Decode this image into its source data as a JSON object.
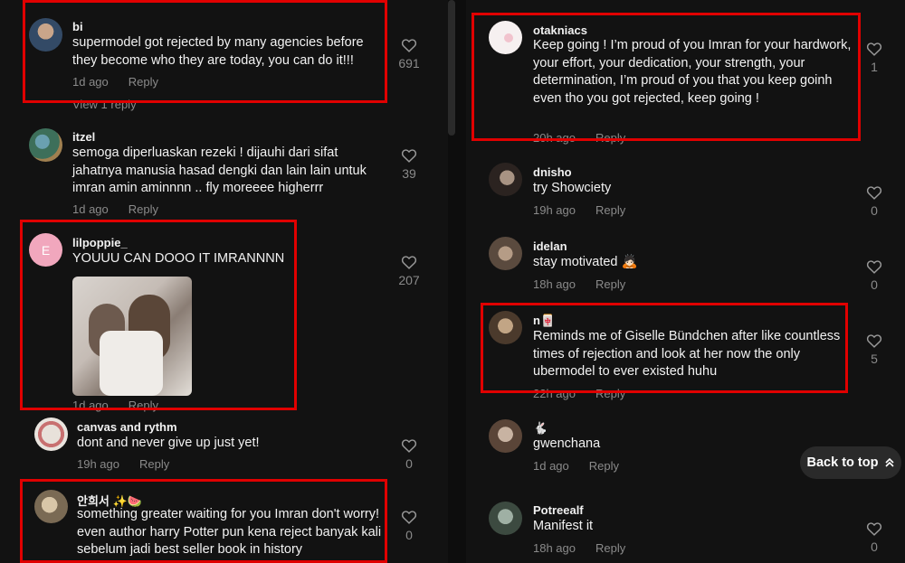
{
  "left": [
    {
      "username": "bi",
      "text": "supermodel got rejected by many agencies before they become who they are today, you can do it!!!",
      "time": "1d ago",
      "reply": "Reply",
      "likes": "691",
      "view_replies": "View 1 reply"
    },
    {
      "username": "itzel",
      "text": "semoga diperluaskan rezeki ! dijauhi dari sifat jahatnya manusia hasad dengki dan lain lain untuk imran amin aminnnn .. fly moreeee higherrr",
      "time": "1d ago",
      "reply": "Reply",
      "likes": "39"
    },
    {
      "username": "lilpoppie_",
      "text": "YOUUU CAN DOOO IT IMRANNNN",
      "time": "1d ago",
      "reply": "Reply",
      "likes": "207",
      "avatar_letter": "E"
    },
    {
      "username": "canvas and rythm",
      "text": "dont and never give up just yet!",
      "time": "19h ago",
      "reply": "Reply",
      "likes": "0"
    },
    {
      "username": "안희서 ✨🍉",
      "text": "something greater waiting for you Imran don't worry! even author harry Potter pun kena reject banyak kali sebelum jadi best seller book in history",
      "time": "",
      "reply": "",
      "likes": "0"
    }
  ],
  "right": [
    {
      "username": "otakniacs",
      "text": "Keep going ! I’m proud of you Imran for your hardwork, your effort, your dedication, your strength, your determination, I’m proud of you that you keep goinh even tho you got rejected, keep going !",
      "time": "20h ago",
      "reply": "Reply",
      "likes": "1"
    },
    {
      "username": "dnisho",
      "text": "try Showciety",
      "time": "19h ago",
      "reply": "Reply",
      "likes": "0"
    },
    {
      "username": "idelan",
      "text": "stay motivated 🙇🏻",
      "time": "18h ago",
      "reply": "Reply",
      "likes": "0"
    },
    {
      "username": "n🀄",
      "text": "Reminds me of Giselle Bündchen after like countless times of rejection and look at her now the only ubermodel to ever existed huhu",
      "time": "22h ago",
      "reply": "Reply",
      "likes": "5"
    },
    {
      "username": "🐇",
      "text": "gwenchana",
      "time": "1d ago",
      "reply": "Reply",
      "likes": ""
    },
    {
      "username": "Potreealf",
      "text": "Manifest it",
      "time": "18h ago",
      "reply": "Reply",
      "likes": "0"
    }
  ],
  "back_to_top": "Back to top",
  "colors": {
    "background": "#121212",
    "highlight": "#e00000",
    "meta": "#8a8a8a"
  }
}
